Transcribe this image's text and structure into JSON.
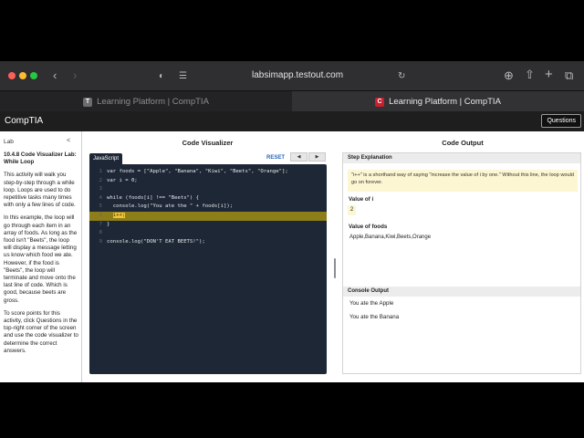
{
  "browser": {
    "url": "labsimapp.testout.com",
    "tabs": [
      {
        "label": "Learning Platform | CompTIA",
        "favicon": "T",
        "active": false
      },
      {
        "label": "Learning Platform | CompTIA",
        "favicon": "C",
        "active": true
      }
    ],
    "icons": [
      "sidebar-icon",
      "back-icon",
      "forward-icon",
      "privacy-shield-icon",
      "reader-icon",
      "reload-icon",
      "download-icon",
      "share-icon",
      "new-tab-icon",
      "tab-overview-icon"
    ]
  },
  "header": {
    "brand": "CompTIA",
    "questions_label": "Questions"
  },
  "sidebar": {
    "label": "Lab",
    "collapse_glyph": "<",
    "title": "10.4.8 Code Visualizer Lab: While Loop",
    "paragraphs": [
      "This activity will walk you step-by-step through a while loop. Loops are used to do repetitive tasks many times with only a few lines of code.",
      "In this example, the loop will go through each item in an array of foods. As long as the food isn't \"Beets\", the loop will display a message letting us know which food we ate. However, if the food is \"Beets\", the loop will terminate and move onto the last line of code. Which is good, because beets are gross.",
      "To score points for this activity, click Questions in the top-right corner of the screen and use the code visualizer to determine the correct answers."
    ]
  },
  "visualizer": {
    "title": "Code Visualizer",
    "reset_label": "RESET",
    "prev_glyph": "◀",
    "next_glyph": "▶",
    "language_tab": "JavaScript",
    "highlight_line": 6,
    "lines": [
      {
        "n": "1",
        "code": "var foods = [\"Apple\", \"Banana\", \"Kiwi\", \"Beets\", \"Orange\"];"
      },
      {
        "n": "2",
        "code": "var i = 0;"
      },
      {
        "n": "3",
        "code": ""
      },
      {
        "n": "4",
        "code": "while (foods[i] !== \"Beets\") {"
      },
      {
        "n": "5",
        "code": "  console.log(\"You ate the \" + foods[i]);"
      },
      {
        "n": "6",
        "code": "  i++;"
      },
      {
        "n": "7",
        "code": "}"
      },
      {
        "n": "8",
        "code": ""
      },
      {
        "n": "9",
        "code": "console.log(\"DON'T EAT BEETS!\");"
      }
    ]
  },
  "output": {
    "title": "Code Output",
    "step_header": "Step Explanation",
    "step_text": "\"i++\" is a shorthand way of saying \"increase the value of i by one.\" Without this line, the loop would go on forever.",
    "value_i_label": "Value of i",
    "value_i": "2",
    "value_foods_label": "Value of foods",
    "value_foods": "Apple,Banana,Kiwi,Beets,Orange",
    "console_header": "Console Output",
    "console_lines": [
      "You ate the Apple",
      "You ate the Banana"
    ]
  },
  "colors": {
    "editor_bg": "#1d2735",
    "highlight_line": "#8e7e1a",
    "highlight_token": "#f0c238",
    "explain_bg": "#fdf6d2",
    "reset_link": "#2a66b8"
  }
}
